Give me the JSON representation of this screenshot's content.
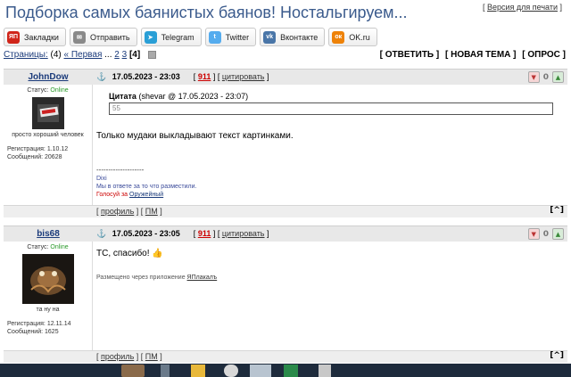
{
  "topic": {
    "title": "Подборка самых баянистых баянов! Ностальгируем...",
    "print_link": "Версия для печати"
  },
  "share": [
    {
      "name": "share-zakladki",
      "label": "Закладки",
      "icon": "ya-icon",
      "icon_text": "ЯП",
      "color": "#d0251a"
    },
    {
      "name": "share-otpravit",
      "label": "Отправить",
      "icon": "mail-icon",
      "icon_text": "✉",
      "color": "#8a8a8a"
    },
    {
      "name": "share-telegram",
      "label": "Telegram",
      "icon": "telegram-icon",
      "icon_text": "➤",
      "color": "#2a9fd6"
    },
    {
      "name": "share-twitter",
      "label": "Twitter",
      "icon": "twitter-icon",
      "icon_text": "t",
      "color": "#55acee"
    },
    {
      "name": "share-vkontakte",
      "label": "Вконтакте",
      "icon": "vk-icon",
      "icon_text": "vk",
      "color": "#4a76a8"
    },
    {
      "name": "share-ok",
      "label": "OK.ru",
      "icon": "ok-icon",
      "icon_text": "ок",
      "color": "#ee8208"
    }
  ],
  "pages": {
    "label": "Страницы:",
    "count": "(4)",
    "first": "« Первая",
    "ellipsis": "...",
    "p2": "2",
    "p3": "3",
    "current": "[4]",
    "actions": [
      "[ ОТВЕТИТЬ ]",
      "[ НОВАЯ ТЕМА ]",
      "[ ОПРОС ]"
    ]
  },
  "posts": [
    {
      "author": "JohnDow",
      "status_label": "Статус:",
      "status_value": "Online",
      "user_label": "просто хороший человек",
      "reg_label": "Регистрация:",
      "reg_value": "1.10.12",
      "msgs_label": "Сообщений:",
      "msgs_value": "20628",
      "date": "17.05.2023 - 23:03",
      "number": "911",
      "quote_link": "цитировать",
      "votes": "0",
      "quote_title": "Цитата",
      "quote_meta": "(shevar @ 17.05.2023 - 23:07)",
      "quote_text": "55",
      "text": "Только мудаки выкладывают текст картинками.",
      "sig_sep": "--------------------",
      "sig_line1": "Dixi",
      "sig_line2": "Мы в ответе за то что разместили.",
      "sig_vote_label": "Голосуй за",
      "sig_vote_link": "Оружейный",
      "profile": "профиль",
      "pm": "ПМ",
      "top": "[^]"
    },
    {
      "author": "bis68",
      "status_label": "Статус:",
      "status_value": "Online",
      "user_label": "та ну на",
      "reg_label": "Регистрация:",
      "reg_value": "12.11.14",
      "msgs_label": "Сообщений:",
      "msgs_value": "1625",
      "date": "17.05.2023 - 23:05",
      "number": "911",
      "quote_link": "цитировать",
      "votes": "0",
      "text": "ТС, спасибо! 👍",
      "app_note": "Размещено через приложение",
      "app_name": "ЯПлакалъ",
      "profile": "профиль",
      "pm": "ПМ",
      "top": "[^]"
    }
  ]
}
